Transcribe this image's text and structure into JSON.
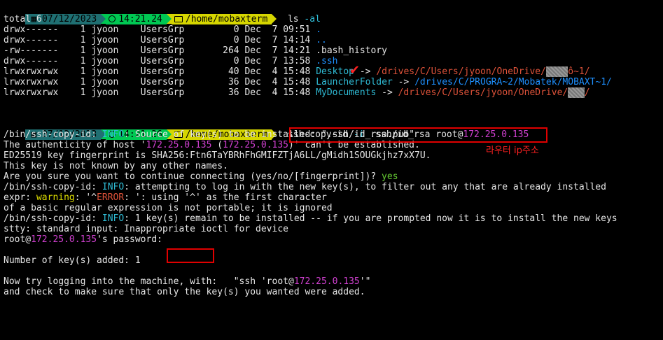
{
  "prompt1": {
    "date": "07/12/2023",
    "time": "14:21.24",
    "path": "/home/mobaxterm",
    "command": "ls",
    "args": "-al"
  },
  "listing": {
    "total": "total 6",
    "rows": [
      {
        "perm": "drwx------",
        "n": "1",
        "user": "jyoon",
        "group": "UsersGrp",
        "size": "0",
        "mon": "Dec",
        "day": "7",
        "time": "09:51",
        "name": "."
      },
      {
        "perm": "drwx------",
        "n": "1",
        "user": "jyoon",
        "group": "UsersGrp",
        "size": "0",
        "mon": "Dec",
        "day": "7",
        "time": "14:14",
        "name": ".."
      },
      {
        "perm": "-rw-------",
        "n": "1",
        "user": "jyoon",
        "group": "UsersGrp",
        "size": "264",
        "mon": "Dec",
        "day": "7",
        "time": "14:21",
        "name": ".bash_history"
      },
      {
        "perm": "drwx------",
        "n": "1",
        "user": "jyoon",
        "group": "UsersGrp",
        "size": "0",
        "mon": "Dec",
        "day": "7",
        "time": "13:58",
        "name": ".ssh"
      },
      {
        "perm": "lrwxrwxrwx",
        "n": "1",
        "user": "jyoon",
        "group": "UsersGrp",
        "size": "40",
        "mon": "Dec",
        "day": "4",
        "time": "15:48",
        "name": "Desktop",
        "arrow": "->",
        "target": "/drives/C/Users/jyoon/OneDrive/",
        "target_tail": "ô~1/"
      },
      {
        "perm": "lrwxrwxrwx",
        "n": "1",
        "user": "jyoon",
        "group": "UsersGrp",
        "size": "36",
        "mon": "Dec",
        "day": "4",
        "time": "15:48",
        "name": "LauncherFolder",
        "arrow": "->",
        "target": "/drives/C/PROGRA~2/Mobatek/MOBAXT~1/"
      },
      {
        "perm": "lrwxrwxrwx",
        "n": "1",
        "user": "jyoon",
        "group": "UsersGrp",
        "size": "36",
        "mon": "Dec",
        "day": "4",
        "time": "15:48",
        "name": "MyDocuments",
        "arrow": "->",
        "target": "/drives/C/Users/jyoon/OneDrive/",
        "target_tail": "/"
      }
    ]
  },
  "prompt2": {
    "date": "07/12/2023",
    "time": "14:21.26",
    "path": "/home/mobaxterm",
    "command": "ssh-copy-id",
    "flag": "-i",
    "keyfile": ".ssh/id_rsa",
    "user_at": "root@",
    "ip": "172.25.0.135"
  },
  "annotation": "라우터 ip주소",
  "output": {
    "l1_a": "/bin/ssh-copy-id: ",
    "l1_b": "INFO",
    "l1_c": ": Source of key(s) to be installed: \".ssh/id_rsa.pub\"",
    "l2_a": "The authenticity of host '",
    "l2_ip1": "172.25.0.135",
    "l2_b": " (",
    "l2_ip2": "172.25.0.135",
    "l2_c": ")' can't be established.",
    "l3": "ED25519 key fingerprint is SHA256:Ftn6TaYBRhFhGMIFZTjA6LL/gMidh1SOUGkjhz7xX7U.",
    "l4": "This key is not known by any other names.",
    "l5_a": "Are you sure you want to continue connecting (yes/no/[fingerprint])? ",
    "l5_b": "yes",
    "l6_a": "/bin/ssh-copy-id: ",
    "l6_b": "INFO",
    "l6_c": ": attempting to log in with the new key(s), to filter out any that are already installed",
    "l7_a": "expr: ",
    "l7_b": "warning",
    "l7_c": ": '^",
    "l7_d": "ERROR",
    "l7_e": ": ': using '^' as the first character",
    "l8": "of a basic regular expression is not portable; it is ignored",
    "l9_a": "/bin/ssh-copy-id: ",
    "l9_b": "INFO",
    "l9_c": ": 1 key(s) remain to be installed -- if you are prompted now it is to install the new keys",
    "l10": "stty: standard input: Inappropriate ioctl for device",
    "l11_a": "root@",
    "l11_ip": "172.25.0.135",
    "l11_b": "'s password:",
    "l13": "Number of key(s) added: 1",
    "l15_a": "Now try logging into the machine, with:   \"ssh 'root@",
    "l15_ip": "172.25.0.135",
    "l15_b": "'\"",
    "l16": "and check to make sure that only the key(s) you wanted were added."
  },
  "colors": {
    "background": "#000000",
    "prompt_date_bg": "#1f6f72",
    "prompt_time_bg": "#00c853",
    "prompt_path_bg": "#d6d600",
    "directory": "#1e90ff",
    "symlink": "#2fbcd6",
    "ip": "#d040d0",
    "link_target": "#e0533a",
    "highlight_box": "#e00000"
  },
  "icons": [
    "calendar-icon",
    "clock-icon",
    "folder-icon",
    "checkmark-icon"
  ]
}
